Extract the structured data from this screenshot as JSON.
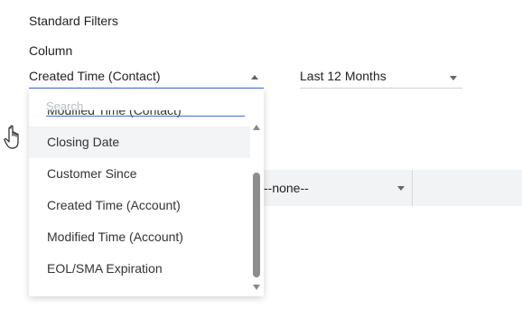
{
  "filters": {
    "section_title": "Standard Filters",
    "column_label": "Column",
    "column_select_value": "Created Time (Contact)",
    "period_select_value": "Last 12 Months",
    "secondary_select_value": "--none--"
  },
  "dropdown": {
    "search_placeholder": "Search",
    "options": [
      "Modified Time (Contact)",
      "Closing Date",
      "Customer Since",
      "Created Time (Account)",
      "Modified Time (Account)",
      "EOL/SMA Expiration"
    ],
    "highlighted_option": "Closing Date"
  },
  "icons": {
    "column_caret": "caret-up-icon",
    "period_caret": "caret-down-icon",
    "cursor": "hand-pointer-icon"
  },
  "colors": {
    "accent": "#3a6fd8",
    "row_background": "#f2f3f5",
    "highlight": "#f3f4f6"
  }
}
